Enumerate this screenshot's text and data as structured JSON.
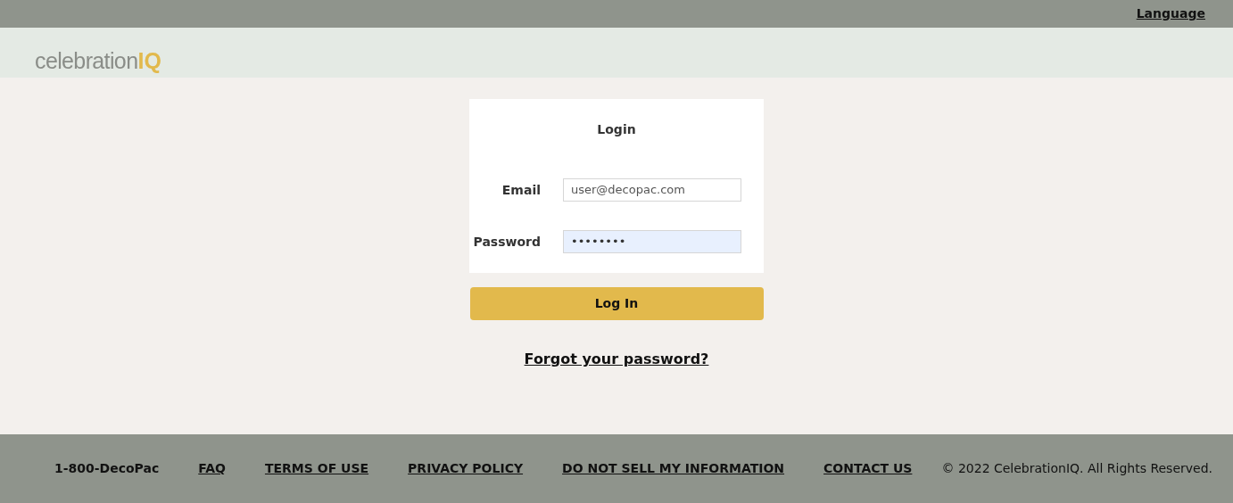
{
  "top_bar": {
    "language_link": "Language"
  },
  "header": {
    "logo": {
      "text": "celebration",
      "accent": "IQ"
    }
  },
  "login": {
    "title": "Login",
    "fields": [
      {
        "label": "Email",
        "value": "user@decopac.com",
        "autofilled": false
      },
      {
        "label": "Password",
        "value": "••••••••",
        "autofilled": true
      }
    ],
    "submit": "Log In",
    "forgot_link": "Forgot your password?"
  },
  "footer": {
    "items": [
      {
        "kind": "text",
        "label": "1-800-DecoPac"
      },
      {
        "kind": "link",
        "label": "FAQ"
      },
      {
        "kind": "link",
        "label": "TERMS OF USE"
      },
      {
        "kind": "link",
        "label": "PRIVACY POLICY"
      },
      {
        "kind": "link",
        "label": "DO NOT SELL MY INFORMATION"
      },
      {
        "kind": "link",
        "label": "CONTACT US"
      }
    ],
    "copyright": "© 2022 CelebrationIQ. All Rights Reserved."
  }
}
